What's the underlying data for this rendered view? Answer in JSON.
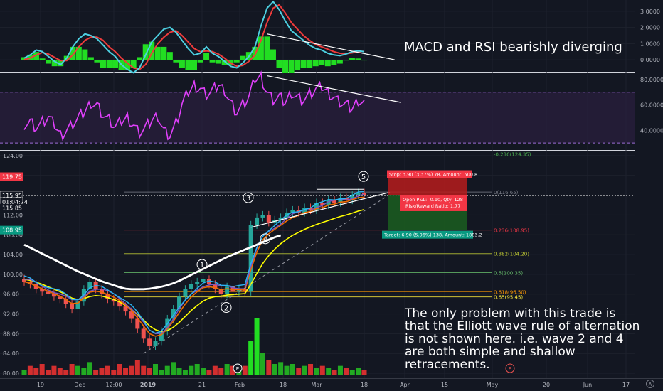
{
  "chart_data": {
    "type": "line",
    "panels": {
      "macd": {
        "ticks": [
          "3.0000",
          "2.0000",
          "1.0000",
          "0.0000"
        ],
        "tick_values": [
          3,
          2,
          1,
          0
        ],
        "ylim": [
          -0.7,
          3.7
        ],
        "macd_line": [
          0.1,
          0.3,
          0.6,
          0.5,
          0.2,
          -0.1,
          -0.3,
          0.1,
          0.8,
          1.3,
          1.6,
          1.5,
          1.3,
          0.9,
          0.5,
          0.2,
          -0.3,
          -0.6,
          -0.8,
          -0.5,
          0.3,
          1.1,
          1.5,
          1.9,
          2.0,
          1.7,
          1.2,
          0.7,
          0.3,
          0.4,
          0.8,
          0.4,
          0.2,
          -0.1,
          -0.4,
          -0.5,
          -0.2,
          0.2,
          0.8,
          2.1,
          3.2,
          3.6,
          3.1,
          2.4,
          1.8,
          1.5,
          1.2,
          0.9,
          0.7,
          0.6,
          0.4,
          0.3,
          0.25,
          0.35,
          0.5,
          0.55,
          0.5
        ],
        "signal_line": [
          0.0,
          0.1,
          0.3,
          0.45,
          0.35,
          0.15,
          -0.05,
          -0.05,
          0.3,
          0.8,
          1.2,
          1.4,
          1.4,
          1.2,
          0.8,
          0.5,
          0.1,
          -0.2,
          -0.5,
          -0.6,
          -0.3,
          0.4,
          1.0,
          1.4,
          1.7,
          1.8,
          1.5,
          1.1,
          0.7,
          0.5,
          0.55,
          0.5,
          0.35,
          0.1,
          -0.2,
          -0.4,
          -0.35,
          -0.1,
          0.3,
          1.2,
          2.3,
          3.2,
          3.4,
          2.9,
          2.3,
          1.9,
          1.5,
          1.2,
          0.95,
          0.8,
          0.65,
          0.5,
          0.4,
          0.38,
          0.42,
          0.5,
          0.52
        ],
        "divergence_line": {
          "x": [
            40,
            61
          ],
          "y": [
            1.6,
            0.0
          ]
        }
      },
      "rsi": {
        "ticks": [
          "80.0000",
          "60.0000",
          "40.0000"
        ],
        "tick_values": [
          80,
          60,
          40
        ],
        "ylim": [
          25,
          85
        ],
        "overbought": 70,
        "oversold": 30,
        "values": [
          45,
          47,
          42,
          46,
          50,
          44,
          36,
          40,
          45,
          50,
          55,
          62,
          60,
          52,
          48,
          42,
          47,
          50,
          44,
          38,
          42,
          48,
          52,
          40,
          36,
          45,
          60,
          70,
          75,
          73,
          68,
          71,
          76,
          72,
          62,
          54,
          60,
          66,
          80,
          82,
          70,
          64,
          66,
          62,
          70,
          66,
          64,
          68,
          72,
          74,
          70,
          66,
          62,
          60,
          57,
          64,
          62
        ],
        "divergence_line": {
          "x": [
            40,
            62
          ],
          "y": [
            83,
            62
          ]
        }
      },
      "price": {
        "ticks": [
          "124.00",
          "120.00",
          "116.00",
          "112.00",
          "108.00",
          "104.00",
          "100.00",
          "96.00",
          "92.00",
          "88.00",
          "84.00",
          "80.00"
        ],
        "tick_values": [
          124,
          120,
          116,
          112,
          108,
          104,
          100,
          96,
          92,
          88,
          84,
          80
        ],
        "ylim": [
          79,
          125
        ],
        "close": [
          98.5,
          98,
          97,
          96.5,
          96,
          95.5,
          95,
          94,
          93,
          94.5,
          97,
          98.5,
          97,
          96,
          95,
          94.5,
          93.5,
          92.5,
          91,
          89,
          87,
          85.5,
          86.5,
          88.5,
          91,
          93,
          95.5,
          97,
          98,
          98.5,
          99,
          98,
          97,
          96,
          97.5,
          96.5,
          97,
          96.5,
          110,
          111.5,
          112,
          110.5,
          111,
          111.5,
          112.5,
          113,
          112.5,
          113.5,
          113,
          114.5,
          114,
          115,
          114.5,
          115.5,
          115,
          116,
          116.5,
          115.95
        ],
        "ema_fast": [
          98.5,
          98.2,
          97.6,
          97.1,
          96.6,
          96.1,
          95.6,
          94.9,
          94.1,
          94.2,
          95.2,
          96.4,
          96.6,
          96.4,
          95.9,
          95.4,
          94.7,
          93.8,
          92.7,
          91.2,
          89.6,
          88,
          87.5,
          87.8,
          89,
          90.5,
          92.3,
          94,
          95.4,
          96.5,
          97.3,
          97.5,
          97.3,
          96.9,
          97.1,
          96.9,
          96.9,
          96.8,
          101,
          104.5,
          107,
          108.2,
          109.1,
          109.9,
          110.8,
          111.5,
          111.9,
          112.5,
          112.7,
          113.3,
          113.5,
          114,
          114.2,
          114.6,
          114.7,
          115.1,
          115.5,
          115.6
        ],
        "ma_slow": [
          99,
          98.8,
          98.4,
          98,
          97.5,
          97,
          96.5,
          95.9,
          95.2,
          94.9,
          95.1,
          95.5,
          95.7,
          95.6,
          95.3,
          94.9,
          94.4,
          93.7,
          92.9,
          91.9,
          90.8,
          89.6,
          88.8,
          88.4,
          88.6,
          89.3,
          90.3,
          91.5,
          92.7,
          93.7,
          94.6,
          95.2,
          95.5,
          95.6,
          95.8,
          95.9,
          96,
          96.1,
          98,
          100.2,
          102.2,
          103.8,
          105.1,
          106.2,
          107.1,
          107.9,
          108.5,
          109.1,
          109.6,
          110.1,
          110.5,
          110.9,
          111.3,
          111.7,
          112,
          112.4,
          112.8,
          113.1
        ],
        "ma200": [
          106,
          105.4,
          104.8,
          104.2,
          103.6,
          103,
          102.4,
          101.8,
          101.2,
          100.6,
          100.1,
          99.6,
          99.1,
          98.6,
          98.2,
          97.8,
          97.4,
          97.1,
          97,
          97,
          97,
          97.1,
          97.3,
          97.5,
          97.8,
          98.2,
          98.7,
          99.3,
          99.9,
          100.5,
          101.1,
          101.7,
          102.3,
          102.9,
          103.5,
          104,
          104.5,
          105,
          105.5,
          106,
          106.5,
          107,
          107.5,
          107.9
        ],
        "ma200_start_index": 0,
        "volume": [
          3,
          5,
          4,
          6,
          3,
          5,
          4,
          3,
          6,
          5,
          4,
          7,
          3,
          4,
          5,
          3,
          6,
          4,
          5,
          8,
          5,
          4,
          6,
          3,
          5,
          7,
          4,
          3,
          5,
          6,
          4,
          3,
          5,
          4,
          6,
          5,
          4,
          5,
          18,
          30,
          12,
          8,
          6,
          7,
          5,
          6,
          4,
          5,
          6,
          4,
          5,
          4,
          3,
          5,
          4,
          3,
          4,
          3
        ],
        "last_price": "115.95",
        "wave_labels": [
          "1",
          "2",
          "3",
          "4",
          "5"
        ],
        "fib_levels": [
          {
            "label": "-0.236(124.35)",
            "value": 124.35,
            "color": "#4caf50"
          },
          {
            "label": "0(116.65)",
            "value": 116.65,
            "color": "#787b86"
          },
          {
            "label": "0.236(108.95)",
            "value": 108.95,
            "color": "#f23645"
          },
          {
            "label": "0.382(104.20)",
            "value": 104.2,
            "color": "#c0ca33"
          },
          {
            "label": "0.5(100.35)",
            "value": 100.35,
            "color": "#66bb6a"
          },
          {
            "label": "0.618(96.50)",
            "value": 96.5,
            "color": "#ff9800"
          },
          {
            "label": "0.65(95.45)",
            "value": 95.45,
            "color": "#ffeb3b"
          }
        ],
        "trade": {
          "entry": 115.95,
          "stop": 119.75,
          "target": 108.95,
          "stop_text": "Stop: 3.90 (3.37%) 78, Amount: 500.8",
          "open_text": "Open P&L: -0.10, Qty: 128",
          "rr_text": "Risk/Reward Ratio: 1.77",
          "target_text": "Target: 6.90 (5.96%) 138, Amount: 1883.2"
        },
        "axis_tags": [
          {
            "text": "119.75",
            "value": 119.75,
            "color": "#f23645"
          },
          {
            "text": "115.95",
            "value": 115.95,
            "color": "#ffffff"
          },
          {
            "text": "01:04:24",
            "value": 114.65,
            "color": "#ffffff"
          },
          {
            "text": "115.85",
            "value": 113.4,
            "color": "#131722"
          },
          {
            "text": "108.95",
            "value": 108.95,
            "color": "#089981"
          }
        ]
      }
    },
    "x_ticks": [
      "19",
      "Dec",
      "12:00",
      "2019",
      "21",
      "Feb",
      "18",
      "Mar",
      "18",
      "Apr",
      "15",
      "May",
      "20",
      "Jun",
      "17"
    ],
    "event_marker": "E"
  },
  "annotations": {
    "macd_note": "MACD and RSI bearishly diverging",
    "problem_note": "The only problem with this trade is\nthat the Elliott wave rule of alternation\nis not shown here. i.e. wave 2 and 4\nare both simple and shallow retracements."
  },
  "corner_label": "A",
  "colors": {
    "background": "#131722",
    "macd_line": "#4dd0e1",
    "signal_line": "#ef3b3b",
    "histogram": "#22dd22",
    "rsi_line": "#e040fb",
    "ema_fast": "#ef6c00",
    "ma_slow": "#ffff00",
    "ma200": "#ffffff",
    "candle_up": "#26a69a",
    "candle_down": "#ef5350"
  }
}
